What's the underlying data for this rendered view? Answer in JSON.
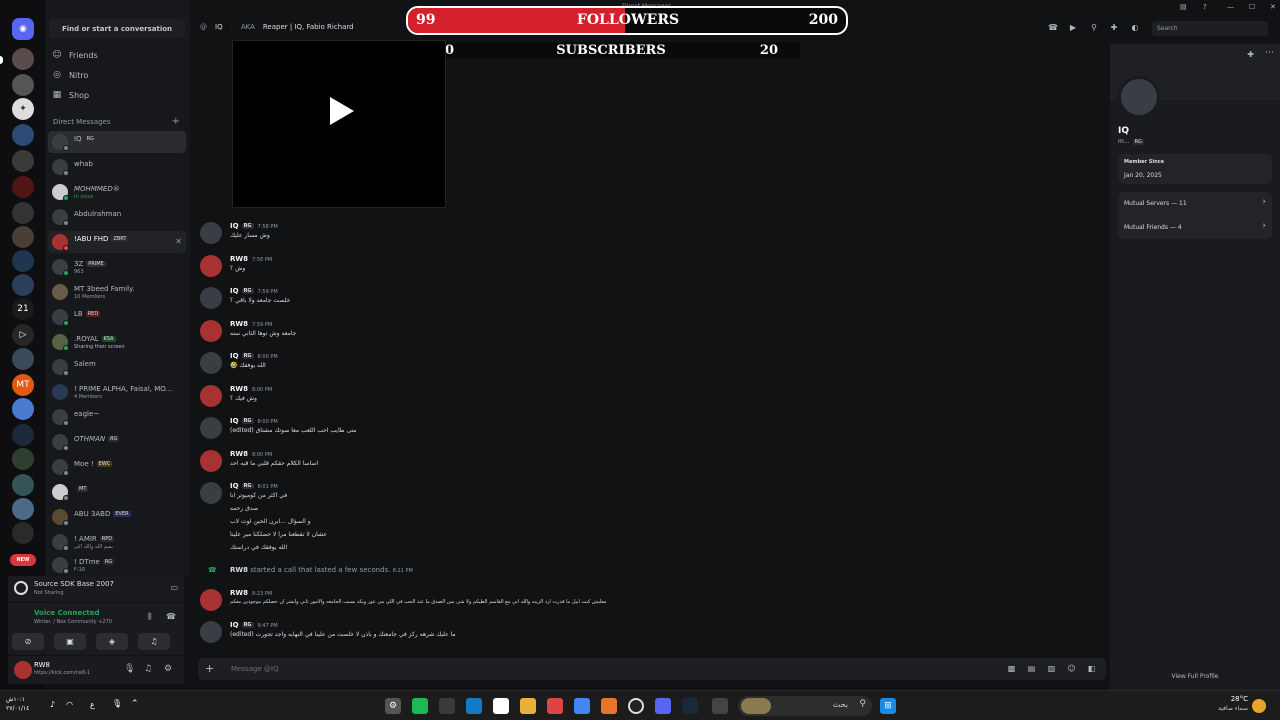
{
  "window": {
    "title": "Direct Messages"
  },
  "overlay": {
    "followers_current": "99",
    "followers_label": "FOLLOWERS",
    "followers_goal": "200",
    "followers_progress": 0.495,
    "subs_current": "0",
    "subs_label": "SUBSCRIBERS",
    "subs_goal": "20"
  },
  "server_rail": {
    "icons": [
      "discord-home-icon",
      "server-icon",
      "server-icon",
      "server-icon",
      "server-icon",
      "server-icon",
      "server-icon",
      "server-icon",
      "server-icon",
      "server-icon",
      "server-icon",
      "server-icon",
      "server-icon",
      "server-icon",
      "server-icon",
      "server-icon",
      "server-icon",
      "server-icon",
      "server-icon",
      "server-icon",
      "server-icon",
      "server-icon"
    ],
    "labels": {
      "s21": "21",
      "mt": "MT",
      "new_badge": "NEW"
    }
  },
  "sidebar": {
    "search_label": "Find or start a conversation",
    "nav": [
      {
        "label": "Friends",
        "icon": "friends-icon"
      },
      {
        "label": "Nitro",
        "icon": "nitro-icon"
      },
      {
        "label": "Shop",
        "icon": "shop-icon"
      }
    ],
    "dm_header": "Direct Messages",
    "dms": [
      {
        "name": "IQ",
        "tag": "RG",
        "sub": ""
      },
      {
        "name": "whab",
        "tag": "",
        "sub": ""
      },
      {
        "name": "MOHMMED®",
        "tag": "",
        "sub": "In voice"
      },
      {
        "name": "Abdulrahman",
        "tag": "",
        "sub": ""
      },
      {
        "name": "!ABU FHD",
        "tag": "ZBRT",
        "sub": ""
      },
      {
        "name": "3Z",
        "tag": "PRIME",
        "sub": "963"
      },
      {
        "name": "MT 3beed Family.",
        "tag": "",
        "sub": "10 Members"
      },
      {
        "name": "LB",
        "tag": "RED",
        "sub": ""
      },
      {
        "name": ".ROYAL",
        "tag": "KSA",
        "sub": "Sharing their screen"
      },
      {
        "name": "Salem",
        "tag": "",
        "sub": ""
      },
      {
        "name": "! PRIME ALPHA, Faisal, MO...",
        "tag": "",
        "sub": "4 Members"
      },
      {
        "name": "eagle~",
        "tag": "",
        "sub": ""
      },
      {
        "name": "OTHMAN",
        "tag": "RG",
        "sub": ""
      },
      {
        "name": "Moe !",
        "tag": "EWC",
        "sub": ""
      },
      {
        "name": "",
        "tag": "MT",
        "sub": ""
      },
      {
        "name": "ABU 3ABD",
        "tag": "EVER",
        "sub": ""
      },
      {
        "name": "! AMIR",
        "tag": "RPD",
        "sub": "بسم الله والله أكبر"
      },
      {
        "name": "! DTme",
        "tag": "RG",
        "sub": "F-16"
      }
    ]
  },
  "activity": {
    "title": "Source SDK Base 2007",
    "sub": "Not Sharing"
  },
  "voice": {
    "status": "Voice Connected",
    "channel": "Winter. / Nox Community +270"
  },
  "user": {
    "name": "RW8",
    "sub": "https://kick.com/rw8-1"
  },
  "header": {
    "channel": "IQ",
    "aka": "AKA",
    "aliases": "Reaper | IQ, Fabio Richard",
    "search_placeholder": "Search"
  },
  "messages": [
    {
      "author": "IQ",
      "tag": "RG",
      "time": "7:58 PM",
      "lines": [
        "وش مسار عليك"
      ]
    },
    {
      "author": "RW8",
      "tag": "",
      "time": "7:58 PM",
      "lines": [
        "وش ؟"
      ]
    },
    {
      "author": "IQ",
      "tag": "RG",
      "time": "7:59 PM",
      "lines": [
        "خلصت جامعه ولا باقي ؟"
      ]
    },
    {
      "author": "RW8",
      "tag": "",
      "time": "7:59 PM",
      "lines": [
        "جامعه وش توها الثاني سنه"
      ]
    },
    {
      "author": "IQ",
      "tag": "RG",
      "time": "8:00 PM",
      "lines": [
        "🤣 الله يوفقك"
      ]
    },
    {
      "author": "RW8",
      "tag": "",
      "time": "8:00 PM",
      "lines": [
        "وش فيك ؟"
      ]
    },
    {
      "author": "IQ",
      "tag": "RG",
      "time": "8:00 PM",
      "lines": [
        "(edited) متى طايب احب اللعب معا صوتك مشتاق"
      ]
    },
    {
      "author": "RW8",
      "tag": "",
      "time": "8:00 PM",
      "lines": [
        "اساسا الكلام حقكم قلبي ما قبه احد"
      ]
    },
    {
      "author": "IQ",
      "tag": "RG",
      "time": "8:01 PM",
      "lines": [
        "في اكثر من كوميوتر انا",
        "صدق رحمه",
        "و السؤال ...ابرن الحين لوت لاب",
        "عشان لا تقطعنا مرا لا حصلكنا مير علينا",
        "الله يوفقك في دراستك"
      ]
    },
    {
      "author": "RW8",
      "tag": "",
      "time": "8:23 PM",
      "lines": [
        "معليش كنت ابيل ما قدرت ارد الزينه والله اني مع القاسم الطيكم ولا شي بس الصدق ما عند الحب في اللي مي عور ويكد بسبب الجامعه والامور ثاني وابشر ان حصلكم موجودين معكم"
      ]
    },
    {
      "author": "IQ",
      "tag": "RG",
      "time": "9:47 PM",
      "lines": [
        "(edited) ما عليك شرهه ركز في جامعتك و باذن لا خلصت من علينا في النهايه واجد تجورت"
      ]
    }
  ],
  "call_event": {
    "author": "RW8",
    "text": "started a call that lasted a few seconds.",
    "time": "8:21 PM"
  },
  "composer": {
    "placeholder": "Message @IQ"
  },
  "profile": {
    "name": "IQ",
    "sub": "m...",
    "tag": "RG",
    "member_since_label": "Member Since",
    "member_since": "Jan 20, 2025",
    "mutual_servers": "Mutual Servers — 11",
    "mutual_friends": "Mutual Friends — 4",
    "view_full": "View Full Profile"
  },
  "taskbar": {
    "search_placeholder": "بحث",
    "time": "١٠:١ش",
    "date": "٢٧/٠١/١٤",
    "weather_temp": "28°C",
    "weather_desc": "سماء صافية",
    "lang": "ع"
  }
}
